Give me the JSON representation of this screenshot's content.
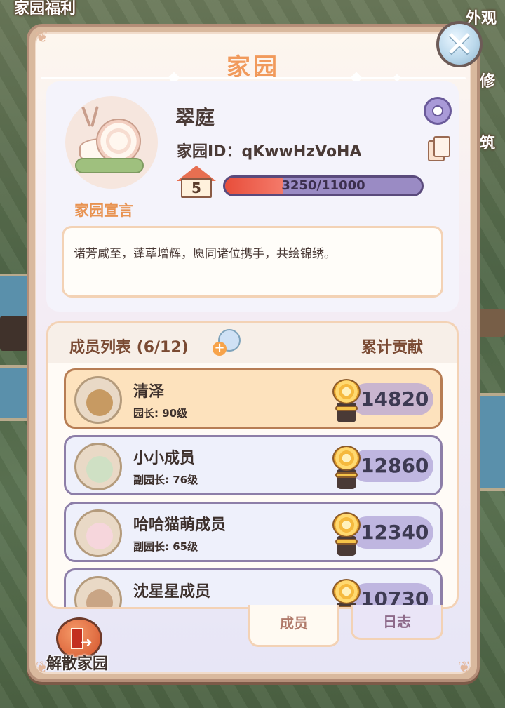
{
  "background": {
    "top_left_label": "家园福利",
    "side_labels": [
      "外观",
      "修",
      "筑"
    ]
  },
  "panel": {
    "title": "家园",
    "close_symbol": "✕"
  },
  "profile": {
    "name": "翠庭",
    "id_label": "家园ID：",
    "id_value": "qKwwHzVoHA",
    "level": "5",
    "exp_text": "3250/11000",
    "exp_fraction": 0.295,
    "manifesto_link": "家园宣言",
    "manifesto": "诸芳咸至，蓬荜增辉，愿同诸位携手，共绘锦绣。"
  },
  "members": {
    "title": "成员列表 (6/12)",
    "contribution_header": "累计贡献",
    "rows": [
      {
        "name": "清泽",
        "role": "园长: 90级",
        "score": "14820",
        "highlight": true,
        "avatar_color": "#c79a62"
      },
      {
        "name": "小小成员",
        "role": "副园长: 76级",
        "score": "12860",
        "highlight": false,
        "avatar_color": "#cfe0c4"
      },
      {
        "name": "哈哈猫萌成员",
        "role": "副园长: 65级",
        "score": "12340",
        "highlight": false,
        "avatar_color": "#f6d6dc"
      },
      {
        "name": "沈星星成员",
        "role": "",
        "score": "10730",
        "highlight": false,
        "avatar_color": "#c9a585"
      }
    ]
  },
  "tabs": {
    "members": "成员",
    "log": "日志"
  },
  "footer": {
    "dissolve_label": "解散家园"
  },
  "colors": {
    "title": "#f19a5c",
    "highlight_row": "#fde2bd",
    "exp_fill": "#e84e3b"
  }
}
